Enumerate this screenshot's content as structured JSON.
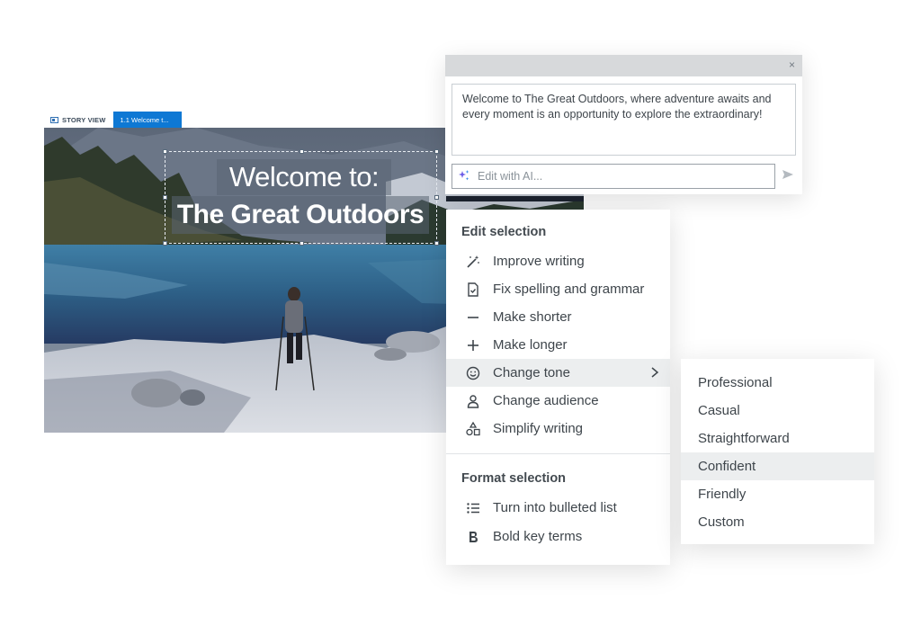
{
  "story_tabs": {
    "story_view": "STORY VIEW",
    "slide_tab": "1.1 Welcome t..."
  },
  "slide": {
    "title_line1": "Welcome to:",
    "title_line2": "The Great Outdoors"
  },
  "ai_panel": {
    "close_icon": "×",
    "message": "Welcome to The Great Outdoors, where adventure awaits and every moment is an opportunity to explore the extraordinary!",
    "input_placeholder": "Edit with AI...",
    "sparkle_icon": "sparkle-icon",
    "send_icon": "send-icon"
  },
  "menu": {
    "edit_heading": "Edit selection",
    "edit_items": [
      {
        "label": "Improve writing",
        "icon": "magic-wand-icon"
      },
      {
        "label": "Fix spelling and grammar",
        "icon": "document-check-icon"
      },
      {
        "label": "Make shorter",
        "icon": "minus-icon"
      },
      {
        "label": "Make longer",
        "icon": "plus-icon"
      },
      {
        "label": "Change tone",
        "icon": "smiley-icon"
      },
      {
        "label": "Change audience",
        "icon": "person-icon"
      },
      {
        "label": "Simplify writing",
        "icon": "shapes-icon"
      }
    ],
    "format_heading": "Format selection",
    "format_items": [
      {
        "label": "Turn into bulleted list",
        "icon": "bulleted-list-icon"
      },
      {
        "label": "Bold key terms",
        "icon": "bold-icon"
      }
    ]
  },
  "tone_submenu": {
    "items": [
      "Professional",
      "Casual",
      "Straightforward",
      "Confident",
      "Friendly",
      "Custom"
    ],
    "highlighted": "Confident"
  },
  "colors": {
    "accent": "#0e78d4",
    "sparkle": "#6b5ce7"
  }
}
